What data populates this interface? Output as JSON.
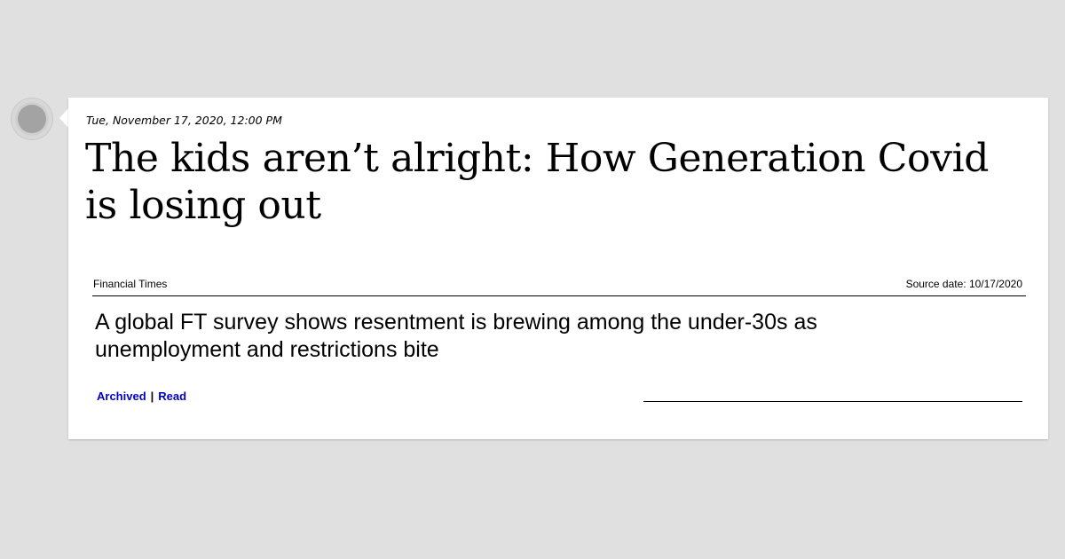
{
  "post": {
    "timestamp": "Tue, November 17, 2020, 12:00 PM",
    "headline": "The kids aren’t alright: How Generation Covid is losing out",
    "source": {
      "name": "Financial Times",
      "date_label": "Source date: 10/17/2020"
    },
    "summary": "A global FT survey shows resentment is brewing among the under-30s as unemployment and restrictions bite",
    "links": {
      "archived": "Archived",
      "separator": "|",
      "read": "Read"
    }
  },
  "colors": {
    "background": "#e0e0e0",
    "card": "#ffffff",
    "link": "#0000cc",
    "avatar": "#a3a3a3"
  },
  "icons": {
    "avatar": "avatar-icon"
  }
}
